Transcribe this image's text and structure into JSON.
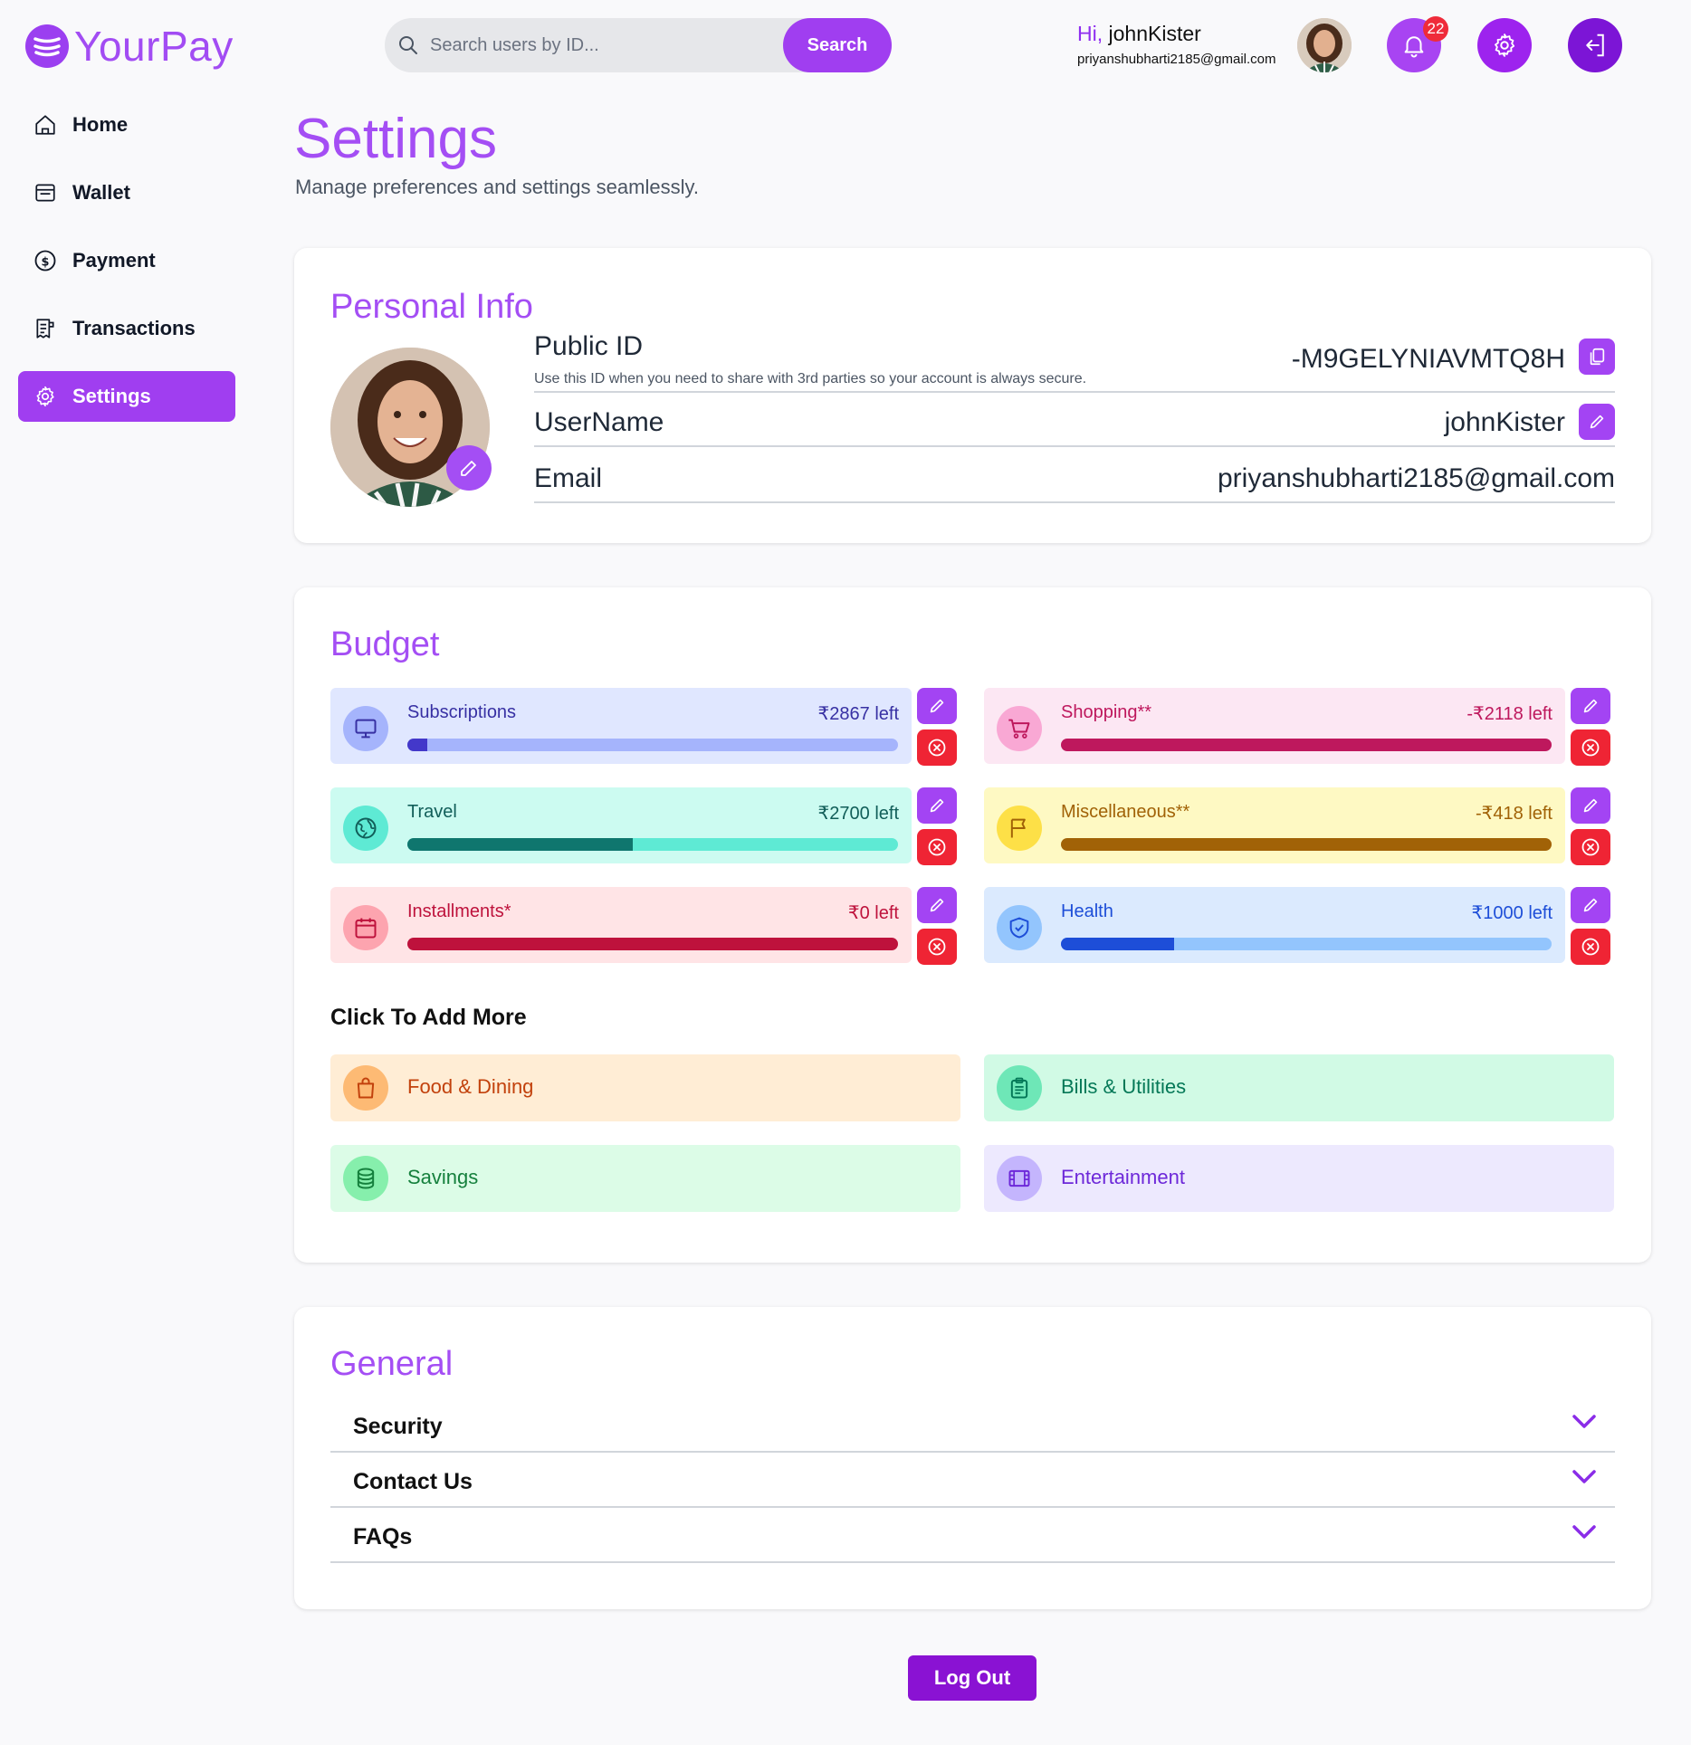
{
  "app": {
    "name": "YourPay"
  },
  "search": {
    "placeholder": "Search users by ID...",
    "button_label": "Search"
  },
  "header": {
    "greeting_prefix": "Hi,",
    "username": " johnKister",
    "email": "priyanshubharti2185@gmail.com",
    "notification_count": "22"
  },
  "sidebar": {
    "items": [
      {
        "label": "Home",
        "icon": "home-icon"
      },
      {
        "label": "Wallet",
        "icon": "wallet-icon"
      },
      {
        "label": "Payment",
        "icon": "payment-icon"
      },
      {
        "label": "Transactions",
        "icon": "receipt-icon"
      },
      {
        "label": "Settings",
        "icon": "gear-icon",
        "active": true
      }
    ]
  },
  "page": {
    "title": "Settings",
    "subtitle": "Manage preferences and settings seamlessly."
  },
  "personal_info": {
    "title": "Personal Info",
    "public_id_label": "Public ID",
    "public_id_help": "Use this ID when you need to share with 3rd parties so your account is always secure.",
    "public_id_value": "-M9GELYNIAVMTQ8H",
    "username_label": "UserName",
    "username_value": "johnKister",
    "email_label": "Email",
    "email_value": "priyanshubharti2185@gmail.com"
  },
  "budget": {
    "title": "Budget",
    "items": [
      {
        "name": "Subscriptions",
        "left": "₹2867 left",
        "progress": 0.04,
        "icon": "monitor-icon",
        "bg": "#e0e7ff",
        "track": "#a5b4fc",
        "fill": "#4338ca",
        "iconBg": "#a5b4fc",
        "text": "#3730a3"
      },
      {
        "name": "Shopping**",
        "left": "-₹2118 left",
        "progress": 1.0,
        "icon": "cart-icon",
        "bg": "#fce7f3",
        "track": "#f9a8d4",
        "fill": "#be185d",
        "iconBg": "#f9a8d4",
        "text": "#be185d"
      },
      {
        "name": "Travel",
        "left": "₹2700 left",
        "progress": 0.46,
        "icon": "globe-icon",
        "bg": "#ccfbf1",
        "track": "#5eead4",
        "fill": "#0f766e",
        "iconBg": "#5eead4",
        "text": "#115e59"
      },
      {
        "name": "Miscellaneous**",
        "left": "-₹418 left",
        "progress": 1.0,
        "icon": "flag-icon",
        "bg": "#fef9c3",
        "track": "#fde047",
        "fill": "#a16207",
        "iconBg": "#fde047",
        "text": "#a16207"
      },
      {
        "name": "Installments*",
        "left": "₹0 left",
        "progress": 1.0,
        "icon": "calendar-icon",
        "bg": "#ffe4e6",
        "track": "#fda4af",
        "fill": "#be123c",
        "iconBg": "#fda4af",
        "text": "#be123c"
      },
      {
        "name": "Health",
        "left": "₹1000 left",
        "progress": 0.23,
        "icon": "shield-icon",
        "bg": "#dbeafe",
        "track": "#93c5fd",
        "fill": "#1d4ed8",
        "iconBg": "#93c5fd",
        "text": "#1d4ed8"
      }
    ],
    "add_title": "Click To Add More",
    "add_items": [
      {
        "label": "Food & Dining",
        "icon": "bag-icon",
        "bg": "#ffedd5",
        "iconBg": "#fdba74",
        "text": "#c2410c"
      },
      {
        "label": "Bills & Utilities",
        "icon": "clipboard-icon",
        "bg": "#d1fae5",
        "iconBg": "#6ee7b7",
        "text": "#047857"
      },
      {
        "label": "Savings",
        "icon": "coins-icon",
        "bg": "#dcfce7",
        "iconBg": "#86efac",
        "text": "#15803d"
      },
      {
        "label": "Entertainment",
        "icon": "film-icon",
        "bg": "#ede9fe",
        "iconBg": "#c4b5fd",
        "text": "#6d28d9"
      }
    ]
  },
  "general": {
    "title": "General",
    "items": [
      {
        "label": "Security"
      },
      {
        "label": "Contact Us"
      },
      {
        "label": "FAQs"
      }
    ]
  },
  "logout_label": "Log Out",
  "colors": {
    "accent": "#a03ef0",
    "danger": "#ef2434"
  }
}
